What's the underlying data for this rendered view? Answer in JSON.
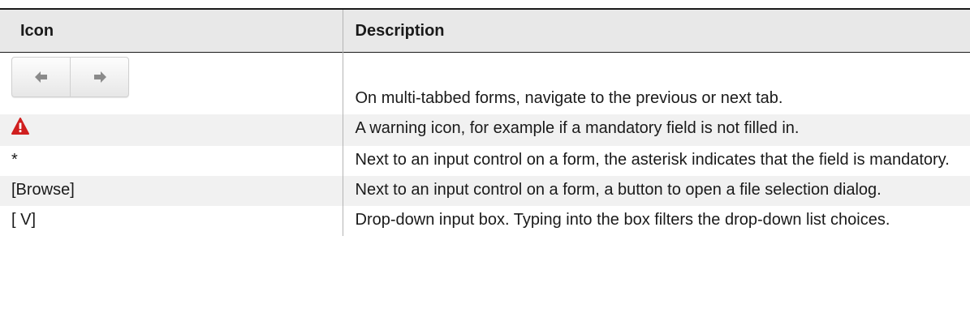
{
  "table": {
    "headers": {
      "icon": "Icon",
      "description": "Description"
    },
    "rows": [
      {
        "icon_kind": "prev-next-buttons",
        "icon_names": [
          "arrow-left-icon",
          "arrow-right-icon"
        ],
        "description": "On multi-tabbed forms, navigate to the previous or next tab."
      },
      {
        "icon_kind": "warning",
        "icon_names": [
          "warning-icon"
        ],
        "icon_color": "#d01f1f",
        "description": "A warning icon, for example if a mandatory field is not filled in."
      },
      {
        "icon_text": "*",
        "description": "Next to an input control on a form, the asterisk indicates that the field is mandatory."
      },
      {
        "icon_text": "[Browse]",
        "description": "Next to an input control on a form, a button to open a file selection dialog."
      },
      {
        "icon_text": "[ V]",
        "description": "Drop-down input box. Typing into the box filters the drop-down list choices."
      }
    ]
  }
}
